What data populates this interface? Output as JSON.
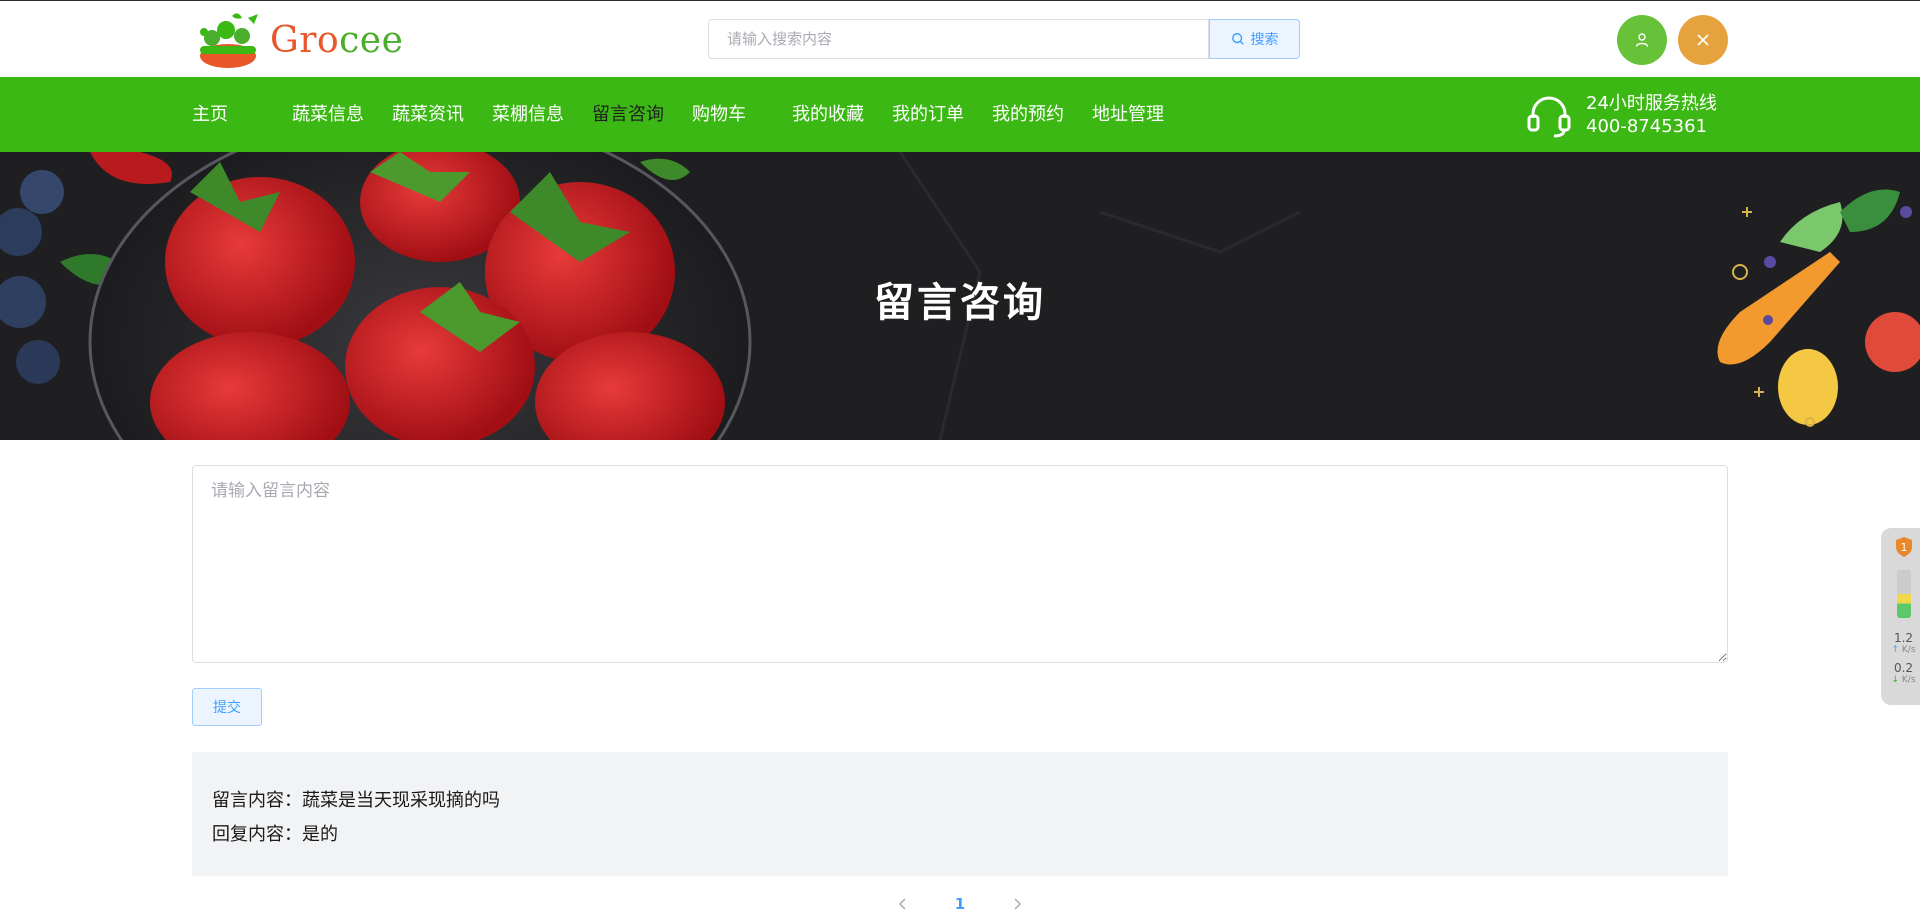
{
  "header": {
    "logo_text_part1": "Gro",
    "logo_text_part2": "cee",
    "search_placeholder": "请输入搜索内容",
    "search_button": "搜索"
  },
  "nav": {
    "items": [
      "主页",
      "蔬菜信息",
      "蔬菜资讯",
      "菜棚信息",
      "留言咨询",
      "购物车",
      "我的收藏",
      "我的订单",
      "我的预约",
      "地址管理"
    ],
    "active": "留言咨询",
    "hotline_label": "24小时服务热线",
    "hotline_number": "400-8745361"
  },
  "banner": {
    "title": "留言咨询"
  },
  "form": {
    "textarea_placeholder": "请输入留言内容",
    "submit_label": "提交"
  },
  "messages": [
    {
      "content_label": "留言内容：",
      "content": "蔬菜是当天现采现摘的吗",
      "reply_label": "回复内容：",
      "reply": "是的"
    }
  ],
  "pagination": {
    "current": "1"
  },
  "widget": {
    "alert_count": "1",
    "upload_rate": "1.2",
    "download_rate": "0.2",
    "rate_unit": "K/s"
  },
  "colors": {
    "primary_green": "#3cb815",
    "logo_orange": "#e8562a",
    "user_button": "#67c23a",
    "close_button": "#e6a23c",
    "link_blue": "#409eff"
  }
}
